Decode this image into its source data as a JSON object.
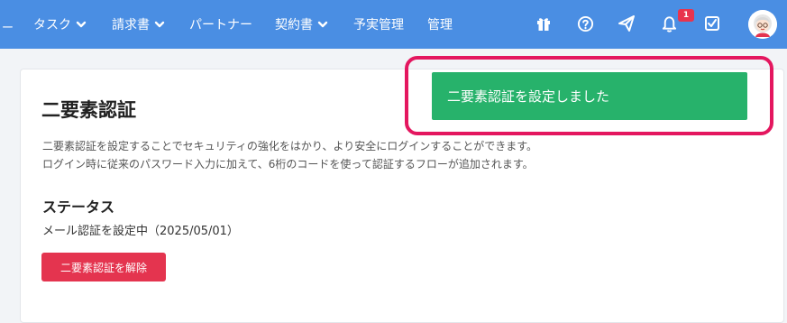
{
  "nav": {
    "cut_label": "ー",
    "items": [
      {
        "label": "タスク",
        "has_dropdown": true
      },
      {
        "label": "請求書",
        "has_dropdown": true
      },
      {
        "label": "パートナー",
        "has_dropdown": false
      },
      {
        "label": "契約書",
        "has_dropdown": true
      },
      {
        "label": "予実管理",
        "has_dropdown": false
      },
      {
        "label": "管理",
        "has_dropdown": false
      }
    ],
    "icons": [
      "gift-icon",
      "help-icon",
      "send-icon",
      "bell-icon",
      "checkbox-icon"
    ],
    "notification_count": "1",
    "avatar": "user-avatar"
  },
  "page": {
    "title": "二要素認証",
    "description_line1": "二要素認証を設定することでセキュリティの強化をはかり、より安全にログインすることができます。",
    "description_line2": "ログイン時に従来のパスワード入力に加えて、6桁のコードを使って認証するフローが追加されます。",
    "status_heading": "ステータス",
    "status_text": "メール認証を設定中（2025/05/01）",
    "disable_button_label": "二要素認証を解除"
  },
  "toast": {
    "message": "二要素認証を設定しました"
  },
  "colors": {
    "nav_bg": "#4a8ee3",
    "toast_bg": "#27b26b",
    "danger": "#e4344f",
    "highlight": "#e4175f"
  }
}
